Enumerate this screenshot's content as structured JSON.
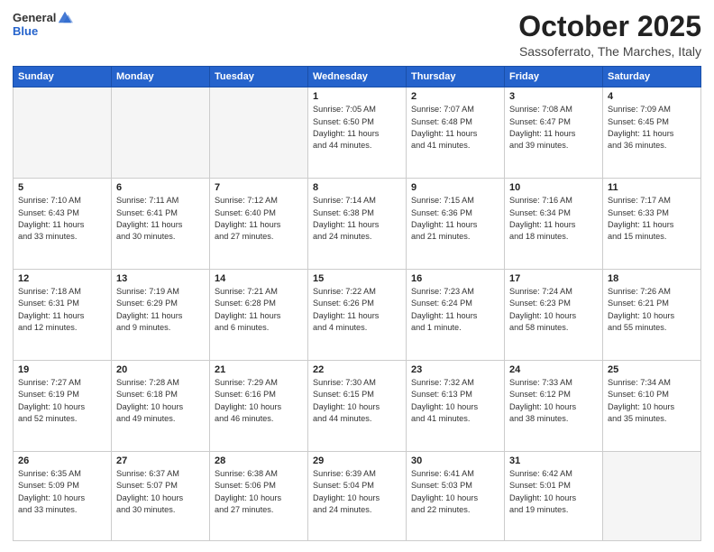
{
  "header": {
    "logo_line1": "General",
    "logo_line2": "Blue",
    "month": "October 2025",
    "location": "Sassoferrato, The Marches, Italy"
  },
  "weekdays": [
    "Sunday",
    "Monday",
    "Tuesday",
    "Wednesday",
    "Thursday",
    "Friday",
    "Saturday"
  ],
  "weeks": [
    [
      {
        "day": "",
        "info": ""
      },
      {
        "day": "",
        "info": ""
      },
      {
        "day": "",
        "info": ""
      },
      {
        "day": "1",
        "info": "Sunrise: 7:05 AM\nSunset: 6:50 PM\nDaylight: 11 hours\nand 44 minutes."
      },
      {
        "day": "2",
        "info": "Sunrise: 7:07 AM\nSunset: 6:48 PM\nDaylight: 11 hours\nand 41 minutes."
      },
      {
        "day": "3",
        "info": "Sunrise: 7:08 AM\nSunset: 6:47 PM\nDaylight: 11 hours\nand 39 minutes."
      },
      {
        "day": "4",
        "info": "Sunrise: 7:09 AM\nSunset: 6:45 PM\nDaylight: 11 hours\nand 36 minutes."
      }
    ],
    [
      {
        "day": "5",
        "info": "Sunrise: 7:10 AM\nSunset: 6:43 PM\nDaylight: 11 hours\nand 33 minutes."
      },
      {
        "day": "6",
        "info": "Sunrise: 7:11 AM\nSunset: 6:41 PM\nDaylight: 11 hours\nand 30 minutes."
      },
      {
        "day": "7",
        "info": "Sunrise: 7:12 AM\nSunset: 6:40 PM\nDaylight: 11 hours\nand 27 minutes."
      },
      {
        "day": "8",
        "info": "Sunrise: 7:14 AM\nSunset: 6:38 PM\nDaylight: 11 hours\nand 24 minutes."
      },
      {
        "day": "9",
        "info": "Sunrise: 7:15 AM\nSunset: 6:36 PM\nDaylight: 11 hours\nand 21 minutes."
      },
      {
        "day": "10",
        "info": "Sunrise: 7:16 AM\nSunset: 6:34 PM\nDaylight: 11 hours\nand 18 minutes."
      },
      {
        "day": "11",
        "info": "Sunrise: 7:17 AM\nSunset: 6:33 PM\nDaylight: 11 hours\nand 15 minutes."
      }
    ],
    [
      {
        "day": "12",
        "info": "Sunrise: 7:18 AM\nSunset: 6:31 PM\nDaylight: 11 hours\nand 12 minutes."
      },
      {
        "day": "13",
        "info": "Sunrise: 7:19 AM\nSunset: 6:29 PM\nDaylight: 11 hours\nand 9 minutes."
      },
      {
        "day": "14",
        "info": "Sunrise: 7:21 AM\nSunset: 6:28 PM\nDaylight: 11 hours\nand 6 minutes."
      },
      {
        "day": "15",
        "info": "Sunrise: 7:22 AM\nSunset: 6:26 PM\nDaylight: 11 hours\nand 4 minutes."
      },
      {
        "day": "16",
        "info": "Sunrise: 7:23 AM\nSunset: 6:24 PM\nDaylight: 11 hours\nand 1 minute."
      },
      {
        "day": "17",
        "info": "Sunrise: 7:24 AM\nSunset: 6:23 PM\nDaylight: 10 hours\nand 58 minutes."
      },
      {
        "day": "18",
        "info": "Sunrise: 7:26 AM\nSunset: 6:21 PM\nDaylight: 10 hours\nand 55 minutes."
      }
    ],
    [
      {
        "day": "19",
        "info": "Sunrise: 7:27 AM\nSunset: 6:19 PM\nDaylight: 10 hours\nand 52 minutes."
      },
      {
        "day": "20",
        "info": "Sunrise: 7:28 AM\nSunset: 6:18 PM\nDaylight: 10 hours\nand 49 minutes."
      },
      {
        "day": "21",
        "info": "Sunrise: 7:29 AM\nSunset: 6:16 PM\nDaylight: 10 hours\nand 46 minutes."
      },
      {
        "day": "22",
        "info": "Sunrise: 7:30 AM\nSunset: 6:15 PM\nDaylight: 10 hours\nand 44 minutes."
      },
      {
        "day": "23",
        "info": "Sunrise: 7:32 AM\nSunset: 6:13 PM\nDaylight: 10 hours\nand 41 minutes."
      },
      {
        "day": "24",
        "info": "Sunrise: 7:33 AM\nSunset: 6:12 PM\nDaylight: 10 hours\nand 38 minutes."
      },
      {
        "day": "25",
        "info": "Sunrise: 7:34 AM\nSunset: 6:10 PM\nDaylight: 10 hours\nand 35 minutes."
      }
    ],
    [
      {
        "day": "26",
        "info": "Sunrise: 6:35 AM\nSunset: 5:09 PM\nDaylight: 10 hours\nand 33 minutes."
      },
      {
        "day": "27",
        "info": "Sunrise: 6:37 AM\nSunset: 5:07 PM\nDaylight: 10 hours\nand 30 minutes."
      },
      {
        "day": "28",
        "info": "Sunrise: 6:38 AM\nSunset: 5:06 PM\nDaylight: 10 hours\nand 27 minutes."
      },
      {
        "day": "29",
        "info": "Sunrise: 6:39 AM\nSunset: 5:04 PM\nDaylight: 10 hours\nand 24 minutes."
      },
      {
        "day": "30",
        "info": "Sunrise: 6:41 AM\nSunset: 5:03 PM\nDaylight: 10 hours\nand 22 minutes."
      },
      {
        "day": "31",
        "info": "Sunrise: 6:42 AM\nSunset: 5:01 PM\nDaylight: 10 hours\nand 19 minutes."
      },
      {
        "day": "",
        "info": ""
      }
    ]
  ]
}
